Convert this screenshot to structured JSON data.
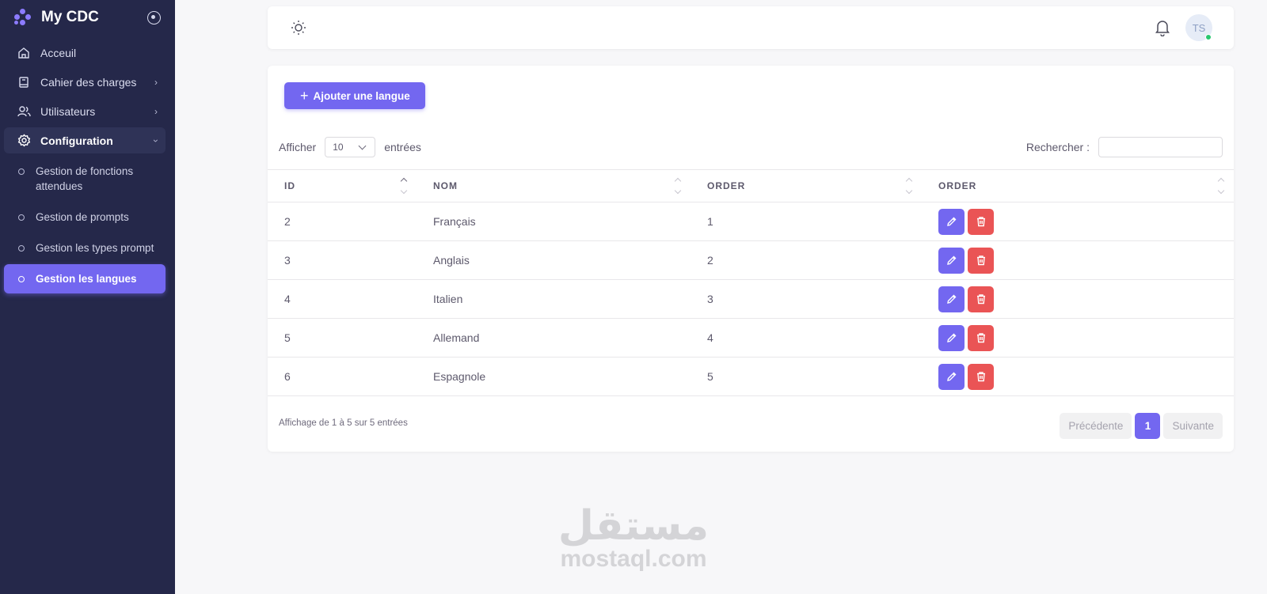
{
  "sidebar": {
    "brand": "My CDC",
    "items": [
      {
        "label": "Acceuil",
        "icon": "home-icon"
      },
      {
        "label": "Cahier des charges",
        "icon": "book-icon"
      },
      {
        "label": "Utilisateurs",
        "icon": "users-icon"
      },
      {
        "label": "Configuration",
        "icon": "gear-icon"
      }
    ],
    "subitems": [
      {
        "label": "Gestion de fonctions attendues"
      },
      {
        "label": "Gestion de prompts"
      },
      {
        "label": "Gestion les types prompt"
      },
      {
        "label": "Gestion les langues"
      }
    ]
  },
  "topbar": {
    "avatar_initials": "TS"
  },
  "main": {
    "add_button": "Ajouter une langue",
    "length": {
      "prefix": "Afficher",
      "value": "10",
      "suffix": "entrées"
    },
    "search_label": "Rechercher :",
    "columns": [
      "ID",
      "NOM",
      "ORDER",
      "ORDER"
    ],
    "rows": [
      {
        "id": "2",
        "nom": "Français",
        "order": "1"
      },
      {
        "id": "3",
        "nom": "Anglais",
        "order": "2"
      },
      {
        "id": "4",
        "nom": "Italien",
        "order": "3"
      },
      {
        "id": "5",
        "nom": "Allemand",
        "order": "4"
      },
      {
        "id": "6",
        "nom": "Espagnole",
        "order": "5"
      }
    ],
    "info": "Affichage de 1 à 5 sur 5 entrées",
    "pagination": {
      "prev": "Précédente",
      "current": "1",
      "next": "Suivante"
    }
  },
  "watermark": {
    "arabic": "مستقل",
    "latin": "mostaql.com"
  },
  "colors": {
    "primary": "#7367f0",
    "danger": "#ea5455",
    "sidebar": "#25284a"
  }
}
